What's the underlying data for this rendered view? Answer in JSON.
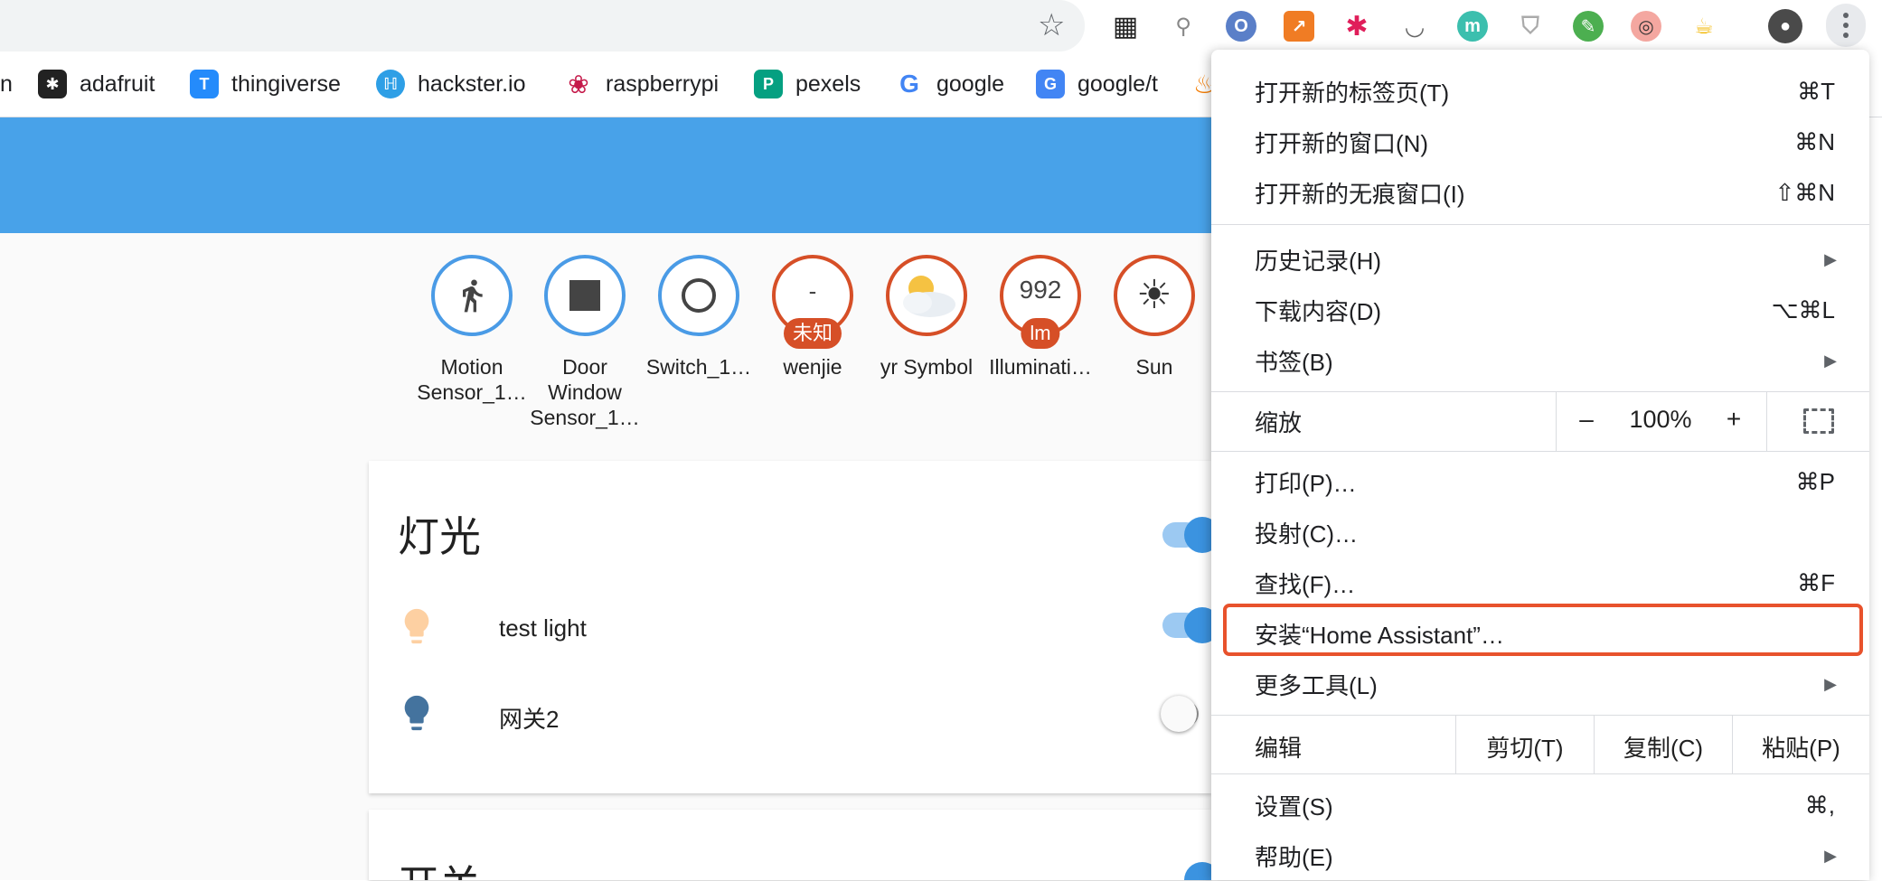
{
  "bookmarks": [
    {
      "label": "n"
    },
    {
      "label": "adafruit"
    },
    {
      "label": "thingiverse"
    },
    {
      "label": "hackster.io"
    },
    {
      "label": "raspberrypi"
    },
    {
      "label": "pexels"
    },
    {
      "label": "google"
    },
    {
      "label": "google/t"
    }
  ],
  "badges": [
    {
      "label_line1": "Motion",
      "label_line2": "Sensor_1…",
      "icon": "walk-icon",
      "style": "blue"
    },
    {
      "label_line1": "Door",
      "label_line2": "Window",
      "label_line3": "Sensor_1…",
      "icon": "square-icon",
      "style": "blue"
    },
    {
      "label_line1": "Switch_1…",
      "icon": "circle-icon",
      "style": "blue"
    },
    {
      "label_line1": "wenjie",
      "value": "-",
      "tag": "未知",
      "style": "red"
    },
    {
      "label_line1": "yr Symbol",
      "icon": "partly-cloudy-icon",
      "style": "red"
    },
    {
      "label_line1": "Illuminati…",
      "value": "992",
      "tag": "lm",
      "style": "red"
    },
    {
      "label_line1": "Sun",
      "icon": "sun-icon",
      "style": "red"
    }
  ],
  "lights_card": {
    "title": "灯光",
    "rows": [
      {
        "label": "test light",
        "icon": "bulb-icon",
        "on": true
      },
      {
        "label": "网关2",
        "icon": "bulb-icon",
        "on": false
      }
    ]
  },
  "switch_card": {
    "title": "开关"
  },
  "menu": {
    "new_tab": {
      "label": "打开新的标签页(T)",
      "shortcut": "⌘T"
    },
    "new_window": {
      "label": "打开新的窗口(N)",
      "shortcut": "⌘N"
    },
    "incognito": {
      "label": "打开新的无痕窗口(I)",
      "shortcut": "⇧⌘N"
    },
    "history": {
      "label": "历史记录(H)"
    },
    "downloads": {
      "label": "下载内容(D)",
      "shortcut": "⌥⌘L"
    },
    "bookmarks": {
      "label": "书签(B)"
    },
    "zoom": {
      "label": "缩放",
      "minus": "–",
      "value": "100%",
      "plus": "+"
    },
    "print": {
      "label": "打印(P)…",
      "shortcut": "⌘P"
    },
    "cast": {
      "label": "投射(C)…"
    },
    "find": {
      "label": "查找(F)…",
      "shortcut": "⌘F"
    },
    "install": {
      "label": "安装“Home Assistant”…"
    },
    "more_tools": {
      "label": "更多工具(L)"
    },
    "edit": {
      "label": "编辑",
      "cut": "剪切(T)",
      "copy": "复制(C)",
      "paste": "粘贴(P)"
    },
    "settings": {
      "label": "设置(S)",
      "shortcut": "⌘,"
    },
    "help": {
      "label": "帮助(E)"
    }
  },
  "colors": {
    "ha_header": "#48a2e9",
    "badge_blue": "#4a9be6",
    "badge_red": "#d64f27",
    "highlight": "#e8522c",
    "toggle_on": "#3b93e0"
  }
}
